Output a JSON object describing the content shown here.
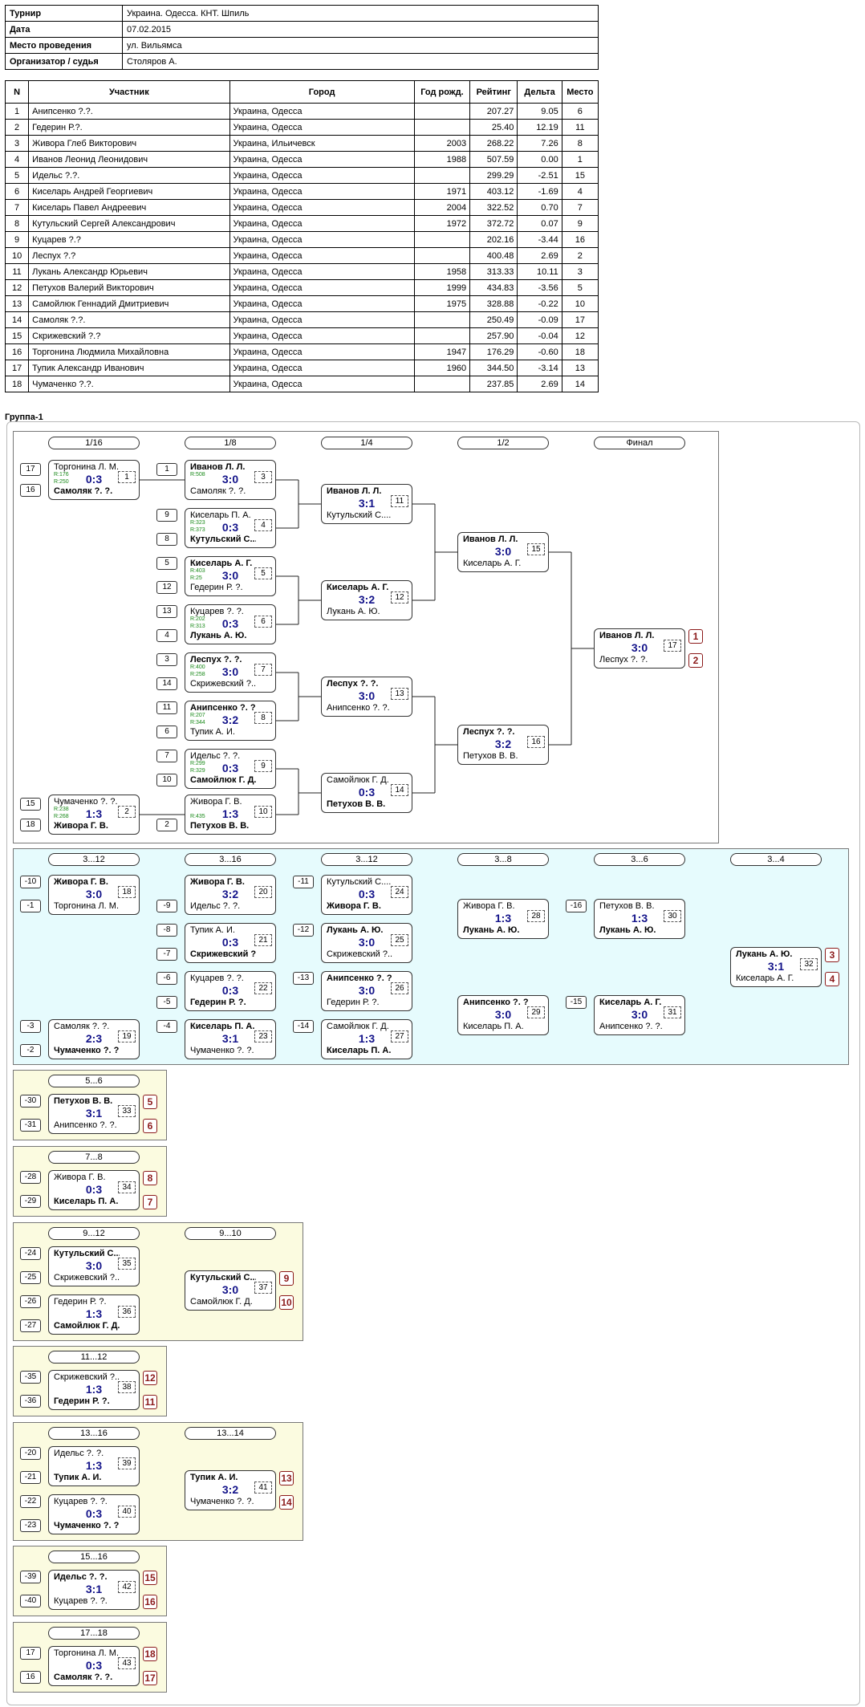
{
  "info": [
    {
      "label": "Турнир",
      "value": "Украина. Одесса. КНТ. Шпиль"
    },
    {
      "label": "Дата",
      "value": "07.02.2015"
    },
    {
      "label": "Место проведения",
      "value": "ул. Вильямса"
    },
    {
      "label": "Организатор / судья",
      "value": "Столяров А."
    }
  ],
  "participants_headers": [
    "N",
    "Участник",
    "Город",
    "Год рожд.",
    "Рейтинг",
    "Дельта",
    "Место"
  ],
  "participants": [
    [
      "1",
      "Анипсенко ?.?.",
      "Украина, Одесса",
      "",
      "207.27",
      "9.05",
      "6"
    ],
    [
      "2",
      "Гедерин Р.?.",
      "Украина, Одесса",
      "",
      "25.40",
      "12.19",
      "11"
    ],
    [
      "3",
      "Живора Глеб Викторович",
      "Украина, Ильичевск",
      "2003",
      "268.22",
      "7.26",
      "8"
    ],
    [
      "4",
      "Иванов Леонид Леонидович",
      "Украина, Одесса",
      "1988",
      "507.59",
      "0.00",
      "1"
    ],
    [
      "5",
      "Идельс ?.?.",
      "Украина, Одесса",
      "",
      "299.29",
      "-2.51",
      "15"
    ],
    [
      "6",
      "Киселарь Андрей Георгиевич",
      "Украина, Одесса",
      "1971",
      "403.12",
      "-1.69",
      "4"
    ],
    [
      "7",
      "Киселарь Павел Андреевич",
      "Украина, Одесса",
      "2004",
      "322.52",
      "0.70",
      "7"
    ],
    [
      "8",
      "Кутульский Сергей Александрович",
      "Украина, Одесса",
      "1972",
      "372.72",
      "0.07",
      "9"
    ],
    [
      "9",
      "Куцарев ?.?",
      "Украина, Одесса",
      "",
      "202.16",
      "-3.44",
      "16"
    ],
    [
      "10",
      "Леспух ?.?",
      "Украина, Одесса",
      "",
      "400.48",
      "2.69",
      "2"
    ],
    [
      "11",
      "Лукань Александр Юрьевич",
      "Украина, Одесса",
      "1958",
      "313.33",
      "10.11",
      "3"
    ],
    [
      "12",
      "Петухов Валерий Викторович",
      "Украина, Одесса",
      "1999",
      "434.83",
      "-3.56",
      "5"
    ],
    [
      "13",
      "Самойлюк Геннадий Дмитриевич",
      "Украина, Одесса",
      "1975",
      "328.88",
      "-0.22",
      "10"
    ],
    [
      "14",
      "Самоляк ?.?.",
      "Украина, Одесса",
      "",
      "250.49",
      "-0.09",
      "17"
    ],
    [
      "15",
      "Скрижевский ?.?",
      "Украина, Одесса",
      "",
      "257.90",
      "-0.04",
      "12"
    ],
    [
      "16",
      "Торгонина Людмила Михайловна",
      "Украина, Одесса",
      "1947",
      "176.29",
      "-0.60",
      "18"
    ],
    [
      "17",
      "Тупик Александр Иванович",
      "Украина, Одесса",
      "1960",
      "344.50",
      "-3.14",
      "13"
    ],
    [
      "18",
      "Чумаченко ?.?.",
      "Украина, Одесса",
      "",
      "237.85",
      "2.69",
      "14"
    ]
  ],
  "group_title": "Группа-1",
  "rounds": {
    "main": [
      "1/16",
      "1/8",
      "1/4",
      "1/2",
      "Финал"
    ],
    "loser": [
      "3...12",
      "3...16",
      "3...12",
      "3...8",
      "3...6",
      "3...4"
    ],
    "r56": "5...6",
    "r78": "7...8",
    "r912": "9...12",
    "r910": "9...10",
    "r1112": "11...12",
    "r1316": "13...16",
    "r1314": "13...14",
    "r1516": "15...16",
    "r1718": "17...18"
  },
  "matches": [
    {
      "num": "1",
      "p1": "Торгонина Л. М.",
      "p2": "Самоляк ?. ?.",
      "score": "0:3",
      "winner": 2,
      "r1": "R:176",
      "r2": "R:250"
    },
    {
      "num": "2",
      "p1": "Чумаченко ?. ?.",
      "p2": "Живора Г. В.",
      "score": "1:3",
      "winner": 2,
      "r1": "R:238",
      "r2": "R:268"
    },
    {
      "num": "3",
      "p1": "Иванов Л. Л.",
      "p2": "Самоляк ?. ?.",
      "score": "3:0",
      "winner": 1,
      "r1": "R:508",
      "r2": ""
    },
    {
      "num": "4",
      "p1": "Киселарь П. А.",
      "p2": "Кутульский С....",
      "score": "0:3",
      "winner": 2,
      "r1": "R:323",
      "r2": "R:373"
    },
    {
      "num": "5",
      "p1": "Киселарь А. Г.",
      "p2": "Гедерин Р. ?.",
      "score": "3:0",
      "winner": 1,
      "r1": "R:403",
      "r2": "R:25"
    },
    {
      "num": "6",
      "p1": "Куцарев ?. ?.",
      "p2": "Лукань А. Ю.",
      "score": "0:3",
      "winner": 2,
      "r1": "R:202",
      "r2": "R:313"
    },
    {
      "num": "7",
      "p1": "Леспух ?. ?.",
      "p2": "Скрижевский ?...",
      "score": "3:0",
      "winner": 1,
      "r1": "R:400",
      "r2": "R:258"
    },
    {
      "num": "8",
      "p1": "Анипсенко ?. ?.",
      "p2": "Тупик А. И.",
      "score": "3:2",
      "winner": 1,
      "r1": "R:207",
      "r2": "R:344"
    },
    {
      "num": "9",
      "p1": "Идельс ?. ?.",
      "p2": "Самойлюк Г. Д.",
      "score": "0:3",
      "winner": 2,
      "r1": "R:299",
      "r2": "R:329"
    },
    {
      "num": "10",
      "p1": "Живора Г. В.",
      "p2": "Петухов В. В.",
      "score": "1:3",
      "winner": 2,
      "r1": "",
      "r2": "R:435"
    },
    {
      "num": "11",
      "p1": "Иванов Л. Л.",
      "p2": "Кутульский С....",
      "score": "3:1",
      "winner": 1,
      "r1": "",
      "r2": ""
    },
    {
      "num": "12",
      "p1": "Киселарь А. Г.",
      "p2": "Лукань А. Ю.",
      "score": "3:2",
      "winner": 1,
      "r1": "",
      "r2": ""
    },
    {
      "num": "13",
      "p1": "Леспух ?. ?.",
      "p2": "Анипсенко ?. ?.",
      "score": "3:0",
      "winner": 1,
      "r1": "",
      "r2": ""
    },
    {
      "num": "14",
      "p1": "Самойлюк Г. Д.",
      "p2": "Петухов В. В.",
      "score": "0:3",
      "winner": 2,
      "r1": "",
      "r2": ""
    },
    {
      "num": "15",
      "p1": "Иванов Л. Л.",
      "p2": "Киселарь А. Г.",
      "score": "3:0",
      "winner": 1,
      "r1": "",
      "r2": ""
    },
    {
      "num": "16",
      "p1": "Леспух ?. ?.",
      "p2": "Петухов В. В.",
      "score": "3:2",
      "winner": 1,
      "r1": "",
      "r2": ""
    },
    {
      "num": "17",
      "p1": "Иванов Л. Л.",
      "p2": "Леспух ?. ?.",
      "score": "3:0",
      "winner": 1,
      "r1": "",
      "r2": ""
    },
    {
      "num": "18",
      "p1": "Живора Г. В.",
      "p2": "Торгонина Л. М.",
      "score": "3:0",
      "winner": 1,
      "r1": "",
      "r2": ""
    },
    {
      "num": "19",
      "p1": "Самоляк ?. ?.",
      "p2": "Чумаченко ?. ?.",
      "score": "2:3",
      "winner": 2,
      "r1": "",
      "r2": ""
    },
    {
      "num": "20",
      "p1": "Живора Г. В.",
      "p2": "Идельс ?. ?.",
      "score": "3:2",
      "winner": 1,
      "r1": "",
      "r2": ""
    },
    {
      "num": "21",
      "p1": "Тупик А. И.",
      "p2": "Скрижевский ?...",
      "score": "0:3",
      "winner": 2,
      "r1": "",
      "r2": ""
    },
    {
      "num": "22",
      "p1": "Куцарев ?. ?.",
      "p2": "Гедерин Р. ?.",
      "score": "0:3",
      "winner": 2,
      "r1": "",
      "r2": ""
    },
    {
      "num": "23",
      "p1": "Киселарь П. А.",
      "p2": "Чумаченко ?. ?.",
      "score": "3:1",
      "winner": 1,
      "r1": "",
      "r2": ""
    },
    {
      "num": "24",
      "p1": "Кутульский С....",
      "p2": "Живора Г. В.",
      "score": "0:3",
      "winner": 2,
      "r1": "",
      "r2": ""
    },
    {
      "num": "25",
      "p1": "Лукань А. Ю.",
      "p2": "Скрижевский ?...",
      "score": "3:0",
      "winner": 1,
      "r1": "",
      "r2": ""
    },
    {
      "num": "26",
      "p1": "Анипсенко ?. ?.",
      "p2": "Гедерин Р. ?.",
      "score": "3:0",
      "winner": 1,
      "r1": "",
      "r2": ""
    },
    {
      "num": "27",
      "p1": "Самойлюк Г. Д.",
      "p2": "Киселарь П. А.",
      "score": "1:3",
      "winner": 2,
      "r1": "",
      "r2": ""
    },
    {
      "num": "28",
      "p1": "Живора Г. В.",
      "p2": "Лукань А. Ю.",
      "score": "1:3",
      "winner": 2,
      "r1": "",
      "r2": ""
    },
    {
      "num": "29",
      "p1": "Анипсенко ?. ?.",
      "p2": "Киселарь П. А.",
      "score": "3:0",
      "winner": 1,
      "r1": "",
      "r2": ""
    },
    {
      "num": "30",
      "p1": "Петухов В. В.",
      "p2": "Лукань А. Ю.",
      "score": "1:3",
      "winner": 2,
      "r1": "",
      "r2": ""
    },
    {
      "num": "31",
      "p1": "Киселарь А. Г.",
      "p2": "Анипсенко ?. ?.",
      "score": "3:0",
      "winner": 1,
      "r1": "",
      "r2": ""
    },
    {
      "num": "32",
      "p1": "Лукань А. Ю.",
      "p2": "Киселарь А. Г.",
      "score": "3:1",
      "winner": 1,
      "r1": "",
      "r2": ""
    },
    {
      "num": "33",
      "p1": "Петухов В. В.",
      "p2": "Анипсенко ?. ?.",
      "score": "3:1",
      "winner": 1,
      "r1": "",
      "r2": ""
    },
    {
      "num": "34",
      "p1": "Живора Г. В.",
      "p2": "Киселарь П. А.",
      "score": "0:3",
      "winner": 2,
      "r1": "",
      "r2": ""
    },
    {
      "num": "35",
      "p1": "Кутульский С....",
      "p2": "Скрижевский ?...",
      "score": "3:0",
      "winner": 1,
      "r1": "",
      "r2": ""
    },
    {
      "num": "36",
      "p1": "Гедерин Р. ?.",
      "p2": "Самойлюк Г. Д.",
      "score": "1:3",
      "winner": 2,
      "r1": "",
      "r2": ""
    },
    {
      "num": "37",
      "p1": "Кутульский С....",
      "p2": "Самойлюк Г. Д.",
      "score": "3:0",
      "winner": 1,
      "r1": "",
      "r2": ""
    },
    {
      "num": "38",
      "p1": "Скрижевский ?...",
      "p2": "Гедерин Р. ?.",
      "score": "1:3",
      "winner": 2,
      "r1": "",
      "r2": ""
    },
    {
      "num": "39",
      "p1": "Идельс ?. ?.",
      "p2": "Тупик А. И.",
      "score": "1:3",
      "winner": 2,
      "r1": "",
      "r2": ""
    },
    {
      "num": "40",
      "p1": "Куцарев ?. ?.",
      "p2": "Чумаченко ?. ?.",
      "score": "0:3",
      "winner": 2,
      "r1": "",
      "r2": ""
    },
    {
      "num": "41",
      "p1": "Тупик А. И.",
      "p2": "Чумаченко ?. ?.",
      "score": "3:2",
      "winner": 1,
      "r1": "",
      "r2": ""
    },
    {
      "num": "42",
      "p1": "Идельс ?. ?.",
      "p2": "Куцарев ?. ?.",
      "score": "3:1",
      "winner": 1,
      "r1": "",
      "r2": ""
    },
    {
      "num": "43",
      "p1": "Торгонина Л. М.",
      "p2": "Самоляк ?. ?.",
      "score": "0:3",
      "winner": 2,
      "r1": "",
      "r2": ""
    }
  ],
  "seeds": [
    "17",
    "16",
    "15",
    "18",
    "1",
    "9",
    "8",
    "5",
    "12",
    "13",
    "4",
    "3",
    "14",
    "11",
    "6",
    "7",
    "10",
    "2",
    "-10",
    "-1",
    "-3",
    "-2",
    "-9",
    "-8",
    "-7",
    "-6",
    "-5",
    "-4",
    "-11",
    "-12",
    "-13",
    "-14",
    "-16",
    "-15",
    "-30",
    "-31",
    "-28",
    "-29",
    "-24",
    "-25",
    "-26",
    "-27",
    "-35",
    "-36",
    "-20",
    "-21",
    "-22",
    "-23",
    "-39",
    "-40",
    "17",
    "16"
  ],
  "places": [
    "1",
    "2",
    "3",
    "4",
    "5",
    "6",
    "8",
    "7",
    "9",
    "10",
    "12",
    "11",
    "13",
    "14",
    "15",
    "16",
    "18",
    "17"
  ]
}
